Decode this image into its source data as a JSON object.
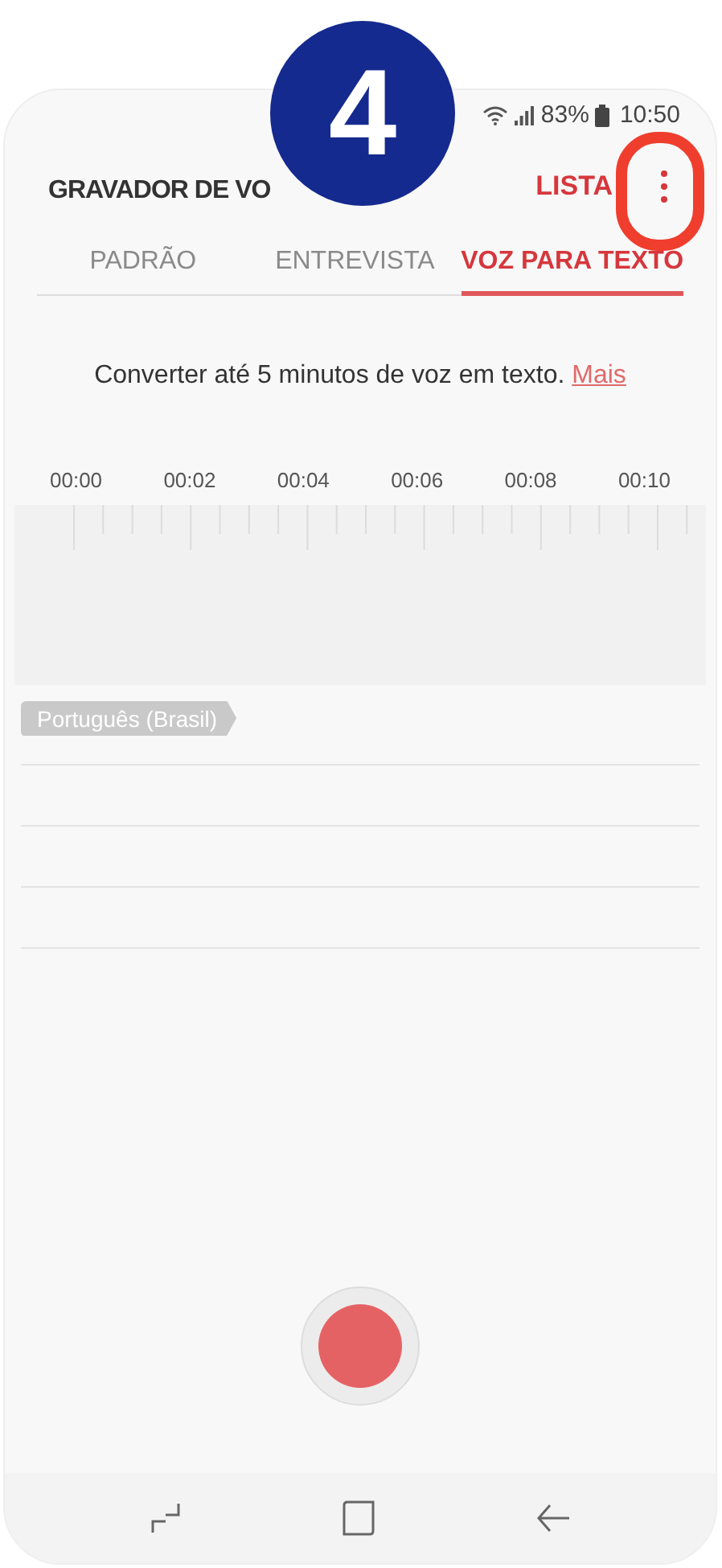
{
  "tutorial": {
    "step": "4"
  },
  "status_bar": {
    "battery": "83%",
    "time": "10:50"
  },
  "app_bar": {
    "title": "GRAVADOR DE VO",
    "action": "LISTA"
  },
  "tabs": [
    {
      "label": "PADRÃO",
      "selected": false
    },
    {
      "label": "ENTREVISTA",
      "selected": false
    },
    {
      "label": "VOZ PARA TEXTO",
      "selected": true
    }
  ],
  "info": {
    "text": "Converter até 5 minutos de voz em texto.",
    "link": "Mais"
  },
  "timeline": {
    "labels": [
      "00:00",
      "00:02",
      "00:04",
      "00:06",
      "00:08",
      "00:10"
    ]
  },
  "language_tag": "Português (Brasil)"
}
